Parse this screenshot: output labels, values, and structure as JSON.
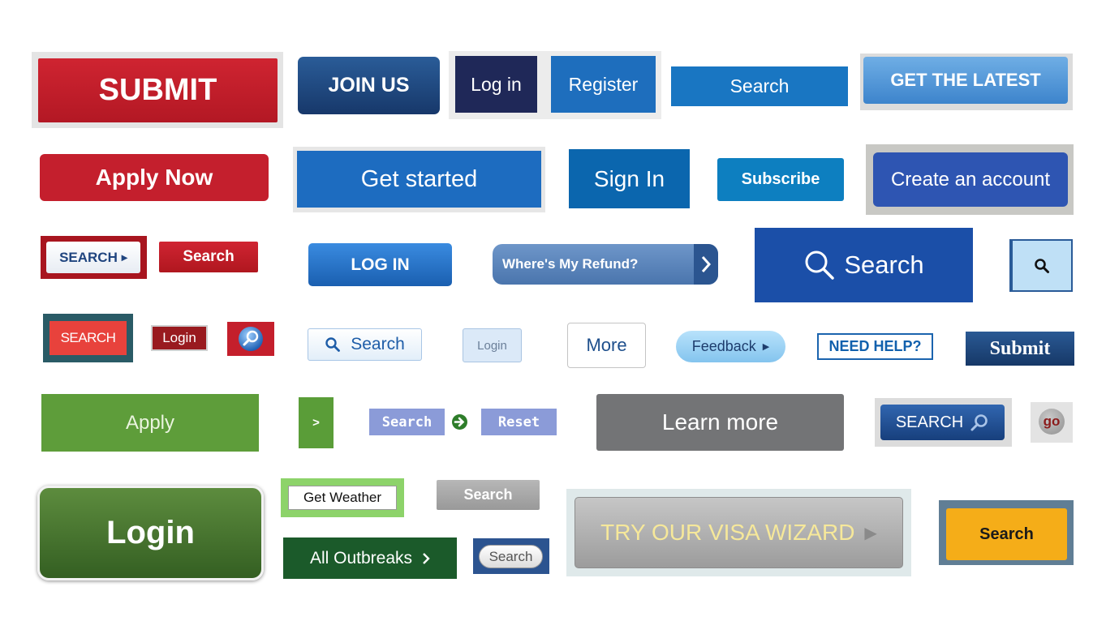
{
  "buttons": {
    "submit_big": "SUBMIT",
    "join_us": "JOIN US",
    "log_in": "Log in",
    "register": "Register",
    "search_top": "Search",
    "get_the_latest": "GET THE LATEST",
    "apply_now": "Apply Now",
    "get_started": "Get started",
    "sign_in": "Sign In",
    "subscribe": "Subscribe",
    "create_account": "Create an account",
    "search_framed": "SEARCH",
    "search_red": "Search",
    "log_in_caps": "LOG IN",
    "wheres_my_refund": "Where's My Refund?",
    "search_large": "Search",
    "search_red_box": "SEARCH",
    "login_small": "Login",
    "search_light": "Search",
    "login_light": "Login",
    "more": "More",
    "feedback": "Feedback",
    "need_help": "NEED HELP?",
    "submit_serif": "Submit",
    "apply": "Apply",
    "arrow_green": ">",
    "search_periwinkle": "Search",
    "reset": "Reset",
    "learn_more": "Learn more",
    "search_blue_caps": "SEARCH",
    "go": "go",
    "login_big": "Login",
    "get_weather": "Get Weather",
    "search_gray": "Search",
    "all_outbreaks": "All Outbreaks",
    "search_pill": "Search",
    "visa_wizard": "TRY OUR VISA WIZARD",
    "search_yellow": "Search"
  },
  "icons": {
    "caret_right": "▸",
    "chevron_right": "›",
    "play": "▶"
  },
  "colors": {
    "red": "#c41f2c",
    "navy": "#1e2a5c",
    "blue": "#1565b3",
    "green": "#5e9c3b",
    "dark_green": "#1b5a2a",
    "gray": "#737476",
    "yellow": "#f5ad18"
  }
}
